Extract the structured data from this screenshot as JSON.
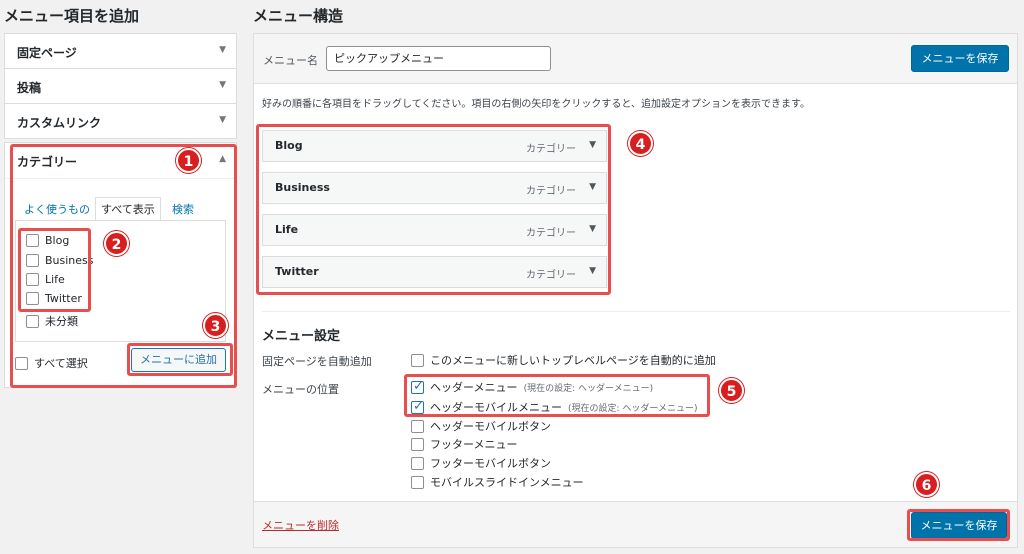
{
  "left": {
    "title": "メニュー項目を追加",
    "accordion": [
      {
        "label": "固定ページ"
      },
      {
        "label": "投稿"
      },
      {
        "label": "カスタムリンク"
      }
    ],
    "category": {
      "label": "カテゴリー",
      "tabs": [
        "よく使うもの",
        "すべて表示",
        "検索"
      ],
      "items": [
        {
          "label": "Blog",
          "checked": false
        },
        {
          "label": "Business",
          "checked": false
        },
        {
          "label": "Life",
          "checked": false
        },
        {
          "label": "Twitter",
          "checked": false
        },
        {
          "label": "未分類",
          "checked": false
        }
      ],
      "select_all": "すべて選択",
      "add_button": "メニューに追加"
    }
  },
  "right": {
    "title": "メニュー構造",
    "menu_name_label": "メニュー名",
    "menu_name_value": "ピックアップメニュー",
    "save_label": "メニューを保存",
    "instructions": "好みの順番に各項目をドラッグしてください。項目の右側の矢印をクリックすると、追加設定オプションを表示できます。",
    "menu_items": [
      {
        "title": "Blog",
        "type": "カテゴリー"
      },
      {
        "title": "Business",
        "type": "カテゴリー"
      },
      {
        "title": "Life",
        "type": "カテゴリー"
      },
      {
        "title": "Twitter",
        "type": "カテゴリー"
      }
    ],
    "settings_title": "メニュー設定",
    "auto_add_label": "固定ページを自動追加",
    "auto_add_option": "このメニューに新しいトップレベルページを自動的に追加",
    "location_label": "メニューの位置",
    "locations": [
      {
        "label": "ヘッダーメニュー",
        "note": "(現在の設定: ヘッダーメニュー)",
        "checked": true
      },
      {
        "label": "ヘッダーモバイルメニュー",
        "note": "(現在の設定: ヘッダーメニュー)",
        "checked": true
      },
      {
        "label": "ヘッダーモバイルボタン",
        "note": "",
        "checked": false
      },
      {
        "label": "フッターメニュー",
        "note": "",
        "checked": false
      },
      {
        "label": "フッターモバイルボタン",
        "note": "",
        "checked": false
      },
      {
        "label": "モバイルスライドインメニュー",
        "note": "",
        "checked": false
      }
    ],
    "delete_label": "メニューを削除"
  },
  "annotations": [
    "1",
    "2",
    "3",
    "4",
    "5",
    "6"
  ],
  "colors": {
    "primary": "#0073aa",
    "highlight": "#e94e4e",
    "badge": "#d81e1e",
    "link": "#0073aa"
  }
}
